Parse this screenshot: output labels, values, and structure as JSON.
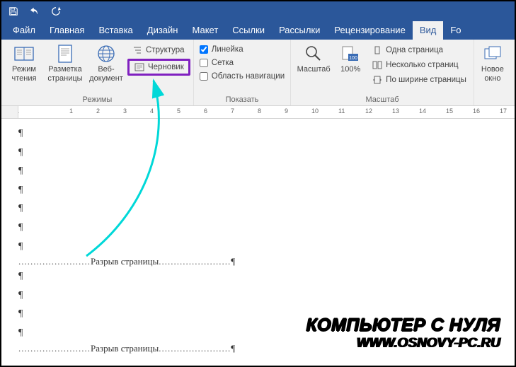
{
  "tabs": {
    "file": "Файл",
    "home": "Главная",
    "insert": "Вставка",
    "design": "Дизайн",
    "layout": "Макет",
    "references": "Ссылки",
    "mailings": "Рассылки",
    "review": "Рецензирование",
    "view": "Вид",
    "extra": "Fo"
  },
  "ribbon": {
    "views": {
      "label": "Режимы",
      "read": "Режим чтения",
      "print": "Разметка страницы",
      "web": "Веб-документ",
      "outline": "Структура",
      "draft": "Черновик"
    },
    "show": {
      "label": "Показать",
      "ruler": "Линейка",
      "grid": "Сетка",
      "nav": "Область навигации"
    },
    "zoom": {
      "label": "Масштаб",
      "zoom": "Масштаб",
      "hundred": "100%",
      "onepage": "Одна страница",
      "multipage": "Несколько страниц",
      "pagewidth": "По ширине страницы"
    },
    "window": {
      "new": "Новое окно"
    }
  },
  "ruler_marks": [
    "1",
    "",
    "1",
    "2",
    "3",
    "4",
    "5",
    "6",
    "7",
    "8",
    "9",
    "10",
    "11",
    "12",
    "13",
    "14",
    "15",
    "16",
    "17"
  ],
  "doc": {
    "pilcrow": "¶",
    "pagebreak": "Разрыв страницы"
  },
  "watermark": {
    "line1": "КОМПЬЮТЕР С НУЛЯ",
    "line2": "WWW.OSNOVY-PC.RU"
  }
}
